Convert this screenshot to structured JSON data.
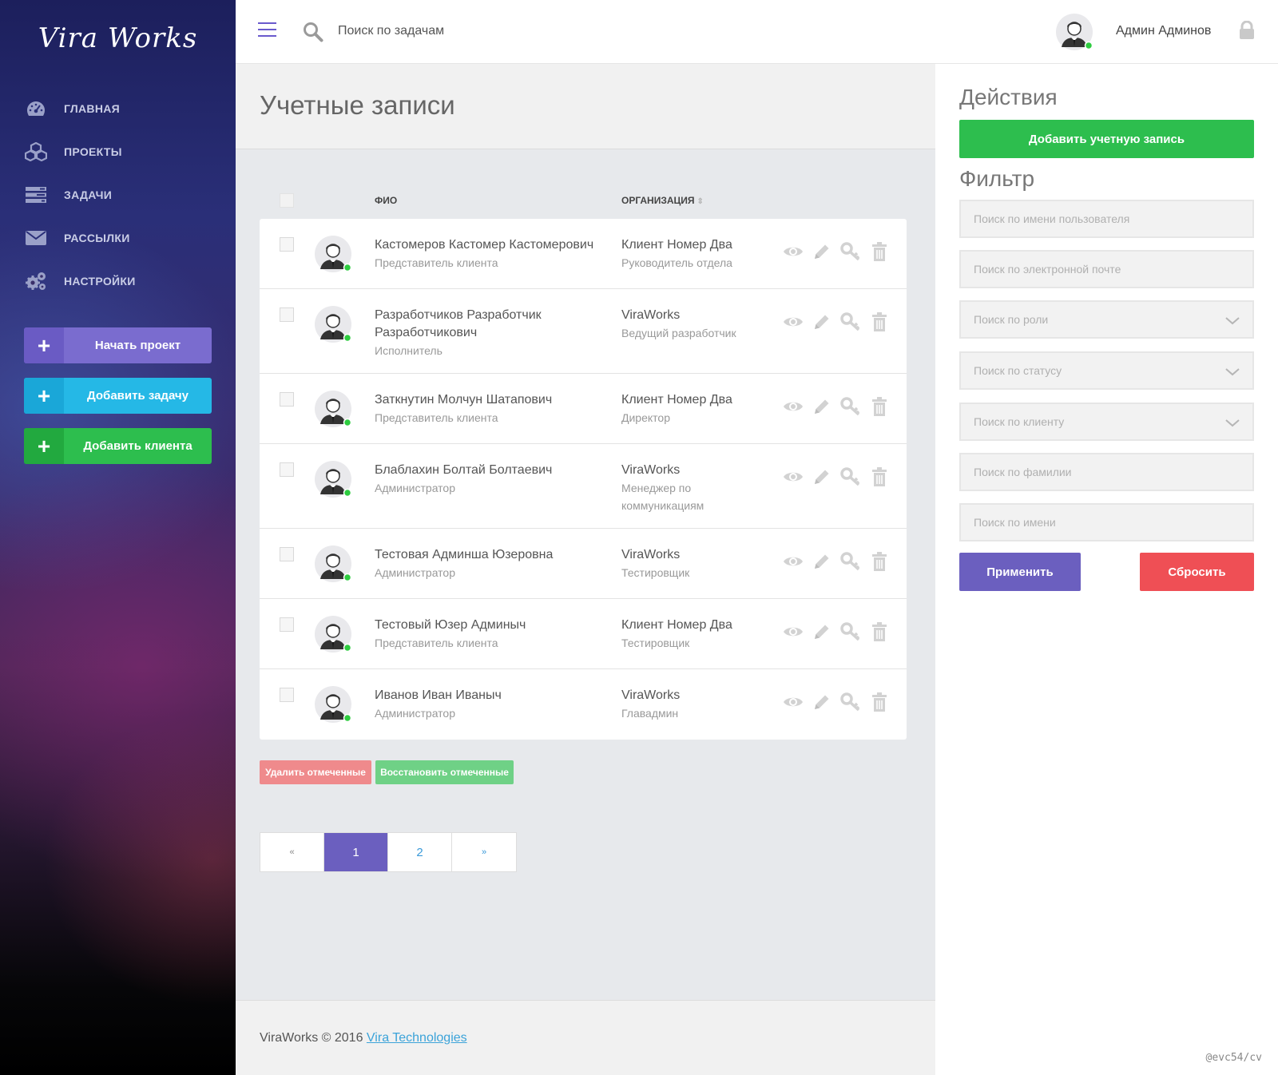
{
  "app": {
    "logo": "Vira Works"
  },
  "sidebar": {
    "nav": [
      {
        "label": "ГЛАВНАЯ",
        "icon": "dashboard-icon"
      },
      {
        "label": "ПРОЕКТЫ",
        "icon": "cubes-icon"
      },
      {
        "label": "ЗАДАЧИ",
        "icon": "tasks-icon"
      },
      {
        "label": "РАССЫЛКИ",
        "icon": "envelope-icon"
      },
      {
        "label": "НАСТРОЙКИ",
        "icon": "gears-icon"
      }
    ],
    "buttons": [
      {
        "label": "Начать проект",
        "color": "#7a6ccf",
        "plus_color": "#6a5bc4"
      },
      {
        "label": "Добавить задачу",
        "color": "#25b8e6",
        "plus_color": "#1aa7d8"
      },
      {
        "label": "Добавить клиента",
        "color": "#2dbe4e",
        "plus_color": "#22a93f"
      }
    ]
  },
  "topbar": {
    "search_placeholder": "Поиск по задачам",
    "user_name": "Админ Админов"
  },
  "main": {
    "title": "Учетные записи",
    "columns": {
      "fio": "ФИО",
      "org": "ОРГАНИЗАЦИЯ"
    },
    "rows": [
      {
        "name": "Кастомеров Кастомер Кастомерович",
        "role": "Представитель клиента",
        "org": "Клиент Номер Два",
        "position": "Руководитель отдела"
      },
      {
        "name": "Разработчиков Разработчик Разработчикович",
        "role": "Исполнитель",
        "org": "ViraWorks",
        "position": "Ведущий разработчик"
      },
      {
        "name": "Заткнутин Молчун Шатапович",
        "role": "Представитель клиента",
        "org": "Клиент Номер Два",
        "position": "Директор"
      },
      {
        "name": "Блаблахин Болтай Болтаевич",
        "role": "Администратор",
        "org": "ViraWorks",
        "position": "Менеджер по коммуникациям"
      },
      {
        "name": "Тестовая Админша Юзеровна",
        "role": "Администратор",
        "org": "ViraWorks",
        "position": "Тестировщик"
      },
      {
        "name": "Тестовый Юзер Админыч",
        "role": "Представитель клиента",
        "org": "Клиент Номер Два",
        "position": "Тестировщик"
      },
      {
        "name": "Иванов Иван Иваныч",
        "role": "Администратор",
        "org": "ViraWorks",
        "position": "Главадмин"
      }
    ],
    "bulk": {
      "delete": "Удалить отмеченные",
      "restore": "Восстановить отмеченные"
    },
    "pagination": [
      "«",
      "1",
      "2",
      "»"
    ],
    "current_page": "1"
  },
  "footer": {
    "text": "ViraWorks © 2016 ",
    "link": "Vira Technologies"
  },
  "panel": {
    "actions_title": "Действия",
    "add_account": "Добавить учетную запись",
    "filter_title": "Фильтр",
    "filters": [
      {
        "placeholder": "Поиск по имени пользователя",
        "type": "input"
      },
      {
        "placeholder": "Поиск по электронной почте",
        "type": "input"
      },
      {
        "placeholder": "Поиск по роли",
        "type": "select"
      },
      {
        "placeholder": "Поиск по статусу",
        "type": "select"
      },
      {
        "placeholder": "Поиск по клиенту",
        "type": "select"
      },
      {
        "placeholder": "Поиск по фамилии",
        "type": "input"
      },
      {
        "placeholder": "Поиск по имени",
        "type": "input"
      }
    ],
    "apply": "Применить",
    "reset": "Сбросить"
  },
  "watermark": "@evc54/cv",
  "colors": {
    "accent": "#6b5fbf",
    "green": "#2dbe4e",
    "red": "#ef4f55",
    "online": "#2ecc40"
  }
}
